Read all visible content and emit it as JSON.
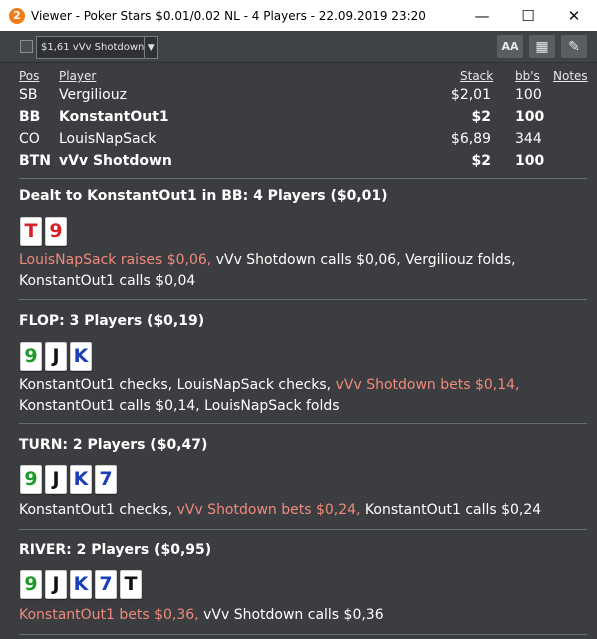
{
  "window": {
    "app_icon_glyph": "2",
    "title": "Viewer - Poker Stars $0.01/0.02 NL - 4 Players - 22.09.2019 23:20",
    "minimize": "—",
    "maximize": "☐",
    "close": "✕"
  },
  "toolbar": {
    "hand_selector_value": "$1,61 vVv Shotdown",
    "dropdown_arrow": "▼",
    "font_size_button": "AA",
    "grid_button": "▦",
    "edit_button": "✎"
  },
  "players_table": {
    "headers": {
      "pos": "Pos",
      "player": "Player",
      "stack": "Stack",
      "bbs": "bb's",
      "notes": "Notes"
    },
    "rows": [
      {
        "pos": "SB",
        "player": "Vergiliouz",
        "stack": "$2,01",
        "bbs": "100",
        "bold": false
      },
      {
        "pos": "BB",
        "player": "KonstantOut1",
        "stack": "$2",
        "bbs": "100",
        "bold": true
      },
      {
        "pos": "CO",
        "player": "LouisNapSack",
        "stack": "$6,89",
        "bbs": "344",
        "bold": false
      },
      {
        "pos": "BTN",
        "player": "vVv Shotdown",
        "stack": "$2",
        "bbs": "100",
        "bold": true
      }
    ]
  },
  "preflop": {
    "title": "Dealt to KonstantOut1 in BB: 4 Players ($0,01)",
    "cards": [
      {
        "rank": "T",
        "suit": "h"
      },
      {
        "rank": "9",
        "suit": "h"
      }
    ],
    "action_red": "LouisNapSack raises $0,06,",
    "action_rest": " vVv Shotdown calls $0,06, Vergiliouz folds, KonstantOut1 calls $0,04"
  },
  "flop": {
    "title": "FLOP: 3 Players ($0,19)",
    "cards": [
      {
        "rank": "9",
        "suit": "c"
      },
      {
        "rank": "J",
        "suit": "s"
      },
      {
        "rank": "K",
        "suit": "d"
      }
    ],
    "action_pre": "KonstantOut1 checks, LouisNapSack checks, ",
    "action_red": "vVv Shotdown bets $0,14,",
    "action_post": " KonstantOut1 calls $0,14, LouisNapSack folds"
  },
  "turn": {
    "title": "TURN: 2 Players ($0,47)",
    "cards": [
      {
        "rank": "9",
        "suit": "c"
      },
      {
        "rank": "J",
        "suit": "s"
      },
      {
        "rank": "K",
        "suit": "d"
      },
      {
        "rank": "7",
        "suit": "d"
      }
    ],
    "action_pre": "KonstantOut1 checks, ",
    "action_red": "vVv Shotdown bets $0,24,",
    "action_post": " KonstantOut1 calls $0,24"
  },
  "river": {
    "title": "RIVER: 2 Players ($0,95)",
    "cards": [
      {
        "rank": "9",
        "suit": "c"
      },
      {
        "rank": "J",
        "suit": "s"
      },
      {
        "rank": "K",
        "suit": "d"
      },
      {
        "rank": "7",
        "suit": "d"
      },
      {
        "rank": "T",
        "suit": "s"
      }
    ],
    "action_red": "KonstantOut1 bets $0,36,",
    "action_post": " vVv Shotdown calls $0,36"
  },
  "colors": {
    "background": "#3b3d40",
    "text": "#ffffff",
    "aggressive_action": "#f08a7a",
    "suit_hearts": "#d8202a",
    "suit_clubs": "#1e9a2a",
    "suit_spades": "#111111",
    "suit_diamonds": "#1a3fb8"
  }
}
